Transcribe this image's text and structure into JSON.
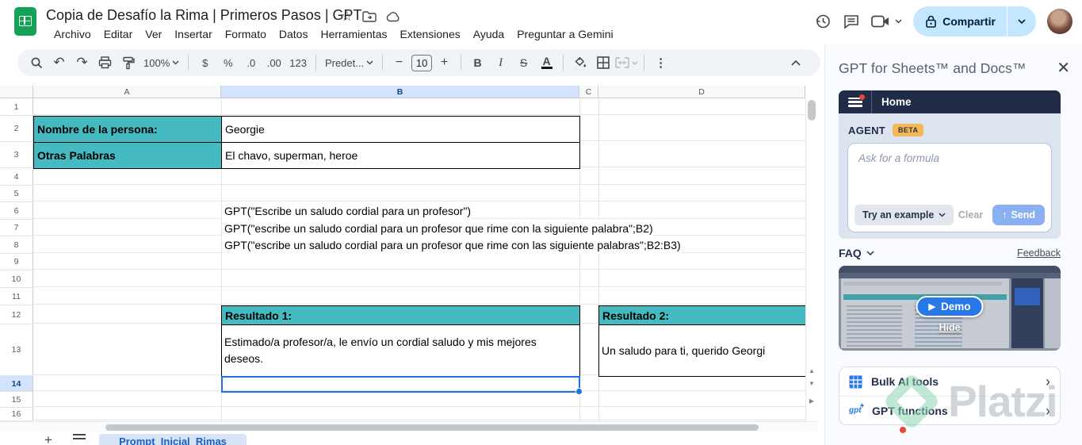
{
  "app": {
    "doc_title": "Copia de Desafío la Rima | Primeros Pasos | GPT",
    "menu_items": [
      "Archivo",
      "Editar",
      "Ver",
      "Insertar",
      "Formato",
      "Datos",
      "Herramientas",
      "Extensiones",
      "Ayuda",
      "Preguntar a Gemini"
    ],
    "share_button": "Compartir"
  },
  "toolbar": {
    "zoom_value": "100%",
    "currency": "$",
    "percent": "%",
    "decimal_decrease": ".0",
    "decimal_increase": ".00",
    "number_format": "123",
    "format_style": "Predet...",
    "font_size": "10",
    "bold": "B",
    "italic": "I",
    "strikethrough": "S",
    "text_color": "A"
  },
  "grid": {
    "column_letters": [
      "A",
      "B",
      "C",
      "D"
    ],
    "row_numbers": [
      "1",
      "2",
      "3",
      "4",
      "5",
      "6",
      "7",
      "8",
      "9",
      "10",
      "11",
      "12",
      "13",
      "14",
      "15",
      "16"
    ],
    "selected_column": "B",
    "selected_row": "14",
    "cells": {
      "a2": "Nombre de la persona:",
      "b2": "Georgie",
      "a3": "Otras Palabras",
      "b3": "El chavo, superman, heroe",
      "b6": "GPT(\"Escribe un saludo cordial para un profesor\")",
      "b7": "GPT(\"escribe un saludo cordial para un profesor que rime con la siguiente palabra\";B2)",
      "b8": "GPT(\"escribe un saludo cordial para un profesor que rime con las siguiente palabras\";B2:B3)",
      "b12": "Resultado 1:",
      "d12": "Resultado 2:",
      "b13": "Estimado/a profesor/a, le envío un cordial saludo y mis mejores deseos.",
      "d13": "Un saludo para ti, querido Georgi"
    }
  },
  "sheet_tabs": {
    "active_tab": "Prompt_Inicial_Rimas"
  },
  "sidebar": {
    "title": "GPT for Sheets™ and Docs™",
    "nav_label": "Home",
    "agent": {
      "label": "AGENT",
      "badge": "BETA",
      "input_placeholder": "Ask for a formula",
      "try_example": "Try an example",
      "clear": "Clear",
      "send": "Send"
    },
    "faq_label": "FAQ",
    "feedback_link": "Feedback",
    "video": {
      "demo_button": "Demo",
      "hide_link": "Hide"
    },
    "menu_cards": [
      {
        "label": "Bulk AI tools",
        "icon": "table-grid-icon"
      },
      {
        "label": "GPT functions",
        "icon": "gpt-logo-icon"
      }
    ]
  },
  "watermark": "Platzi",
  "colors": {
    "cell_teal": "#45BAC0",
    "selection_blue": "#1A73E8",
    "header_highlight": "#D3E3FD",
    "share_pill": "#C2E7FF",
    "sidebar_navy": "#1F2B47",
    "beta_badge": "#F4B954",
    "demo_blue": "#2878E8",
    "send_button": "#8AB0F2"
  }
}
